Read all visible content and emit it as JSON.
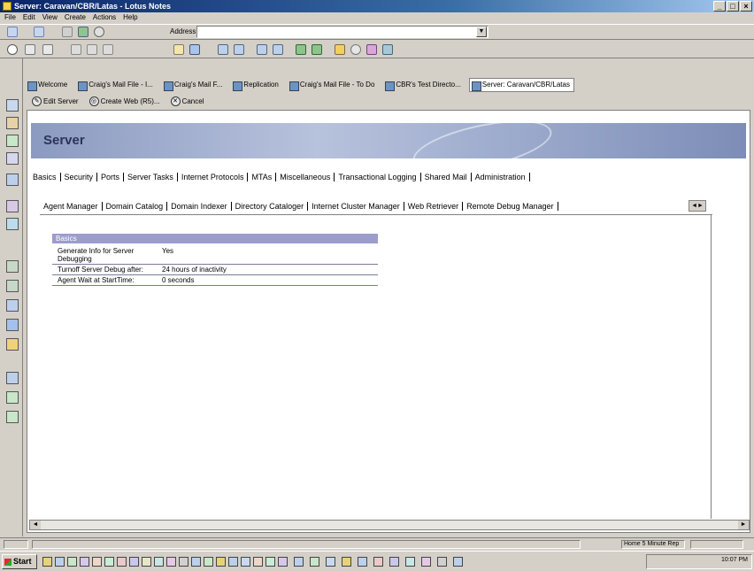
{
  "window": {
    "title": "Server: Caravan/CBR/Latas - Lotus Notes"
  },
  "menu": [
    "File",
    "Edit",
    "View",
    "Create",
    "Actions",
    "Help"
  ],
  "address": {
    "label": "Address",
    "value": ""
  },
  "window_tabs": [
    {
      "label": "Welcome",
      "active": false
    },
    {
      "label": "Craig's Mail File - I...",
      "active": false
    },
    {
      "label": "Craig's Mail F...",
      "active": false
    },
    {
      "label": "Replication",
      "active": false
    },
    {
      "label": "Craig's Mail File - To Do",
      "active": false
    },
    {
      "label": "CBR's Test Directo...",
      "active": false
    },
    {
      "label": "Server: Caravan/CBR/Latas",
      "active": true
    }
  ],
  "actions": {
    "edit": "Edit Server",
    "web": "Create Web (R5)...",
    "cancel": "Cancel"
  },
  "form": {
    "title": "Server",
    "tabs_main": [
      "Basics",
      "Security",
      "Ports",
      "Server Tasks",
      "Internet Protocols",
      "MTAs",
      "Miscellaneous",
      "Transactional Logging",
      "Shared Mail",
      "Administration"
    ],
    "tabs_sub": [
      "Agent Manager",
      "Domain Catalog",
      "Domain Indexer",
      "Directory Cataloger",
      "Internet Cluster Manager",
      "Web Retriever",
      "Remote Debug Manager"
    ],
    "section_title": "Basics",
    "fields": [
      {
        "label": "Generate Info for Server Debugging",
        "value": "Yes"
      },
      {
        "label": "Turnoff Server Debug after:",
        "value": "24 hours of inactivity"
      },
      {
        "label": "Agent Wait at StartTime:",
        "value": "0 seconds"
      }
    ]
  },
  "status": {
    "location": "Home 5 Minute Rep",
    "clock": "10:07 PM"
  },
  "taskbar": {
    "start": "Start"
  },
  "colors": {
    "section": "#9c9ccd",
    "banner": "#9aa8cb",
    "titlebar": "#0a246a"
  }
}
